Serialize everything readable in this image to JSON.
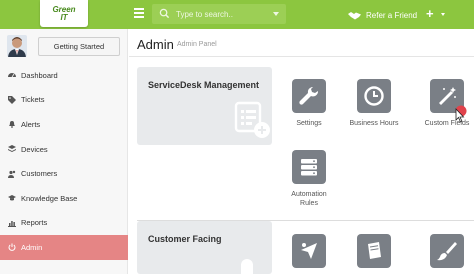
{
  "topbar": {
    "logo_line1": "Green",
    "logo_line2": "IT",
    "search_placeholder": "Type to search..",
    "refer_label": "Refer a Friend",
    "add_label": "+"
  },
  "sidebar": {
    "getting_started_label": "Getting Started",
    "items": [
      {
        "label": "Dashboard",
        "icon": "dashboard-icon"
      },
      {
        "label": "Tickets",
        "icon": "tag-icon"
      },
      {
        "label": "Alerts",
        "icon": "bell-icon"
      },
      {
        "label": "Devices",
        "icon": "layers-icon"
      },
      {
        "label": "Customers",
        "icon": "users-icon"
      },
      {
        "label": "Knowledge Base",
        "icon": "graduation-cap-icon"
      },
      {
        "label": "Reports",
        "icon": "bar-chart-icon"
      },
      {
        "label": "Admin",
        "icon": "power-icon",
        "active": true
      }
    ]
  },
  "main": {
    "title": "Admin",
    "subtitle": "Admin Panel",
    "sections": [
      {
        "title": "ServiceDesk Management",
        "tiles": [
          {
            "label": "Settings",
            "icon": "wrench-icon"
          },
          {
            "label": "Business Hours",
            "icon": "clock-icon"
          },
          {
            "label": "Custom Fields",
            "icon": "magic-wand-icon"
          },
          {
            "label_line1": "Automation",
            "label_line2": "Rules",
            "icon": "server-icon"
          }
        ]
      },
      {
        "title": "Customer Facing",
        "tiles": [
          {
            "label": "",
            "icon": "paper-plane-icon"
          },
          {
            "label": "",
            "icon": "book-icon"
          },
          {
            "label": "",
            "icon": "paint-brush-icon"
          }
        ]
      }
    ]
  },
  "colors": {
    "brand_green": "#8cc63f",
    "active_item": "#e58585",
    "tile_grey": "#7a7f86",
    "panel_bg": "#e8eaec",
    "cursor_badge": "#e0424b"
  }
}
